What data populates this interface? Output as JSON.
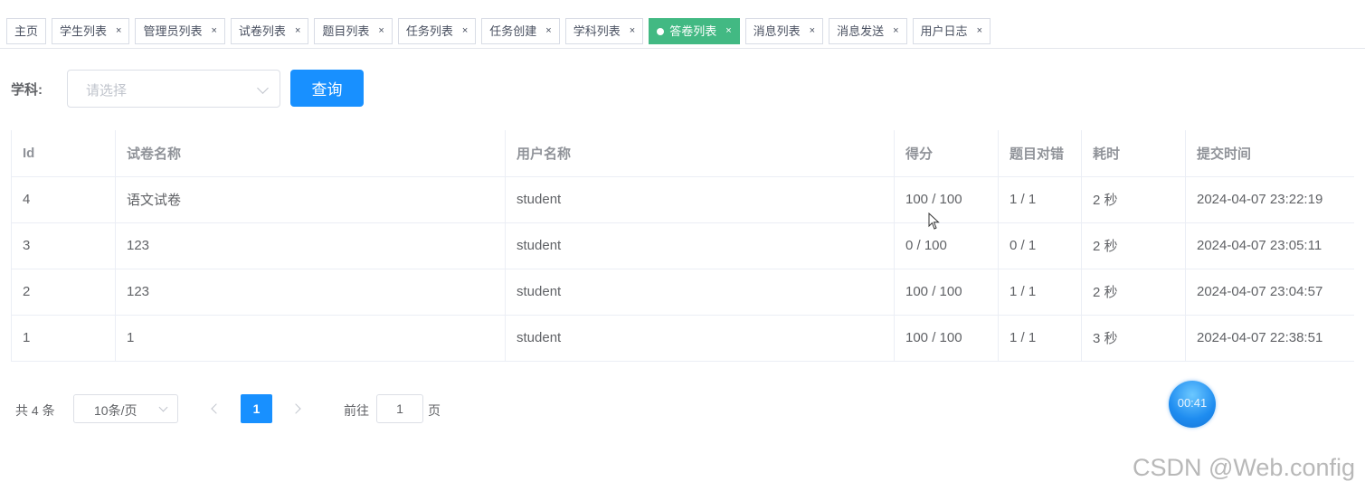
{
  "tags": [
    {
      "label": "主页",
      "closable": false,
      "active": false
    },
    {
      "label": "学生列表",
      "closable": true,
      "active": false
    },
    {
      "label": "管理员列表",
      "closable": true,
      "active": false
    },
    {
      "label": "试卷列表",
      "closable": true,
      "active": false
    },
    {
      "label": "题目列表",
      "closable": true,
      "active": false
    },
    {
      "label": "任务列表",
      "closable": true,
      "active": false
    },
    {
      "label": "任务创建",
      "closable": true,
      "active": false
    },
    {
      "label": "学科列表",
      "closable": true,
      "active": false
    },
    {
      "label": "答卷列表",
      "closable": true,
      "active": true
    },
    {
      "label": "消息列表",
      "closable": true,
      "active": false
    },
    {
      "label": "消息发送",
      "closable": true,
      "active": false
    },
    {
      "label": "用户日志",
      "closable": true,
      "active": false
    }
  ],
  "close_glyph": "×",
  "query": {
    "subject_label": "学科:",
    "subject_placeholder": "请选择",
    "search_button": "查询"
  },
  "table": {
    "columns": [
      "Id",
      "试卷名称",
      "用户名称",
      "得分",
      "题目对错",
      "耗时",
      "提交时间"
    ],
    "rows": [
      [
        "4",
        "语文试卷",
        "student",
        "100 / 100",
        "1 / 1",
        "2 秒",
        "2024-04-07 23:22:19"
      ],
      [
        "3",
        "123",
        "student",
        "0 / 100",
        "0 / 1",
        "2 秒",
        "2024-04-07 23:05:11"
      ],
      [
        "2",
        "123",
        "student",
        "100 / 100",
        "1 / 1",
        "2 秒",
        "2024-04-07 23:04:57"
      ],
      [
        "1",
        "1",
        "student",
        "100 / 100",
        "1 / 1",
        "3 秒",
        "2024-04-07 22:38:51"
      ]
    ]
  },
  "pagination": {
    "total_text": "共 4 条",
    "page_size": "10条/页",
    "current_page": "1",
    "goto_prefix": "前往",
    "goto_value": "1",
    "goto_suffix": "页"
  },
  "timer": {
    "time": "00:41"
  },
  "watermark": "CSDN @Web.config",
  "colors": {
    "primary": "#1890ff",
    "active_tag": "#42b983"
  }
}
